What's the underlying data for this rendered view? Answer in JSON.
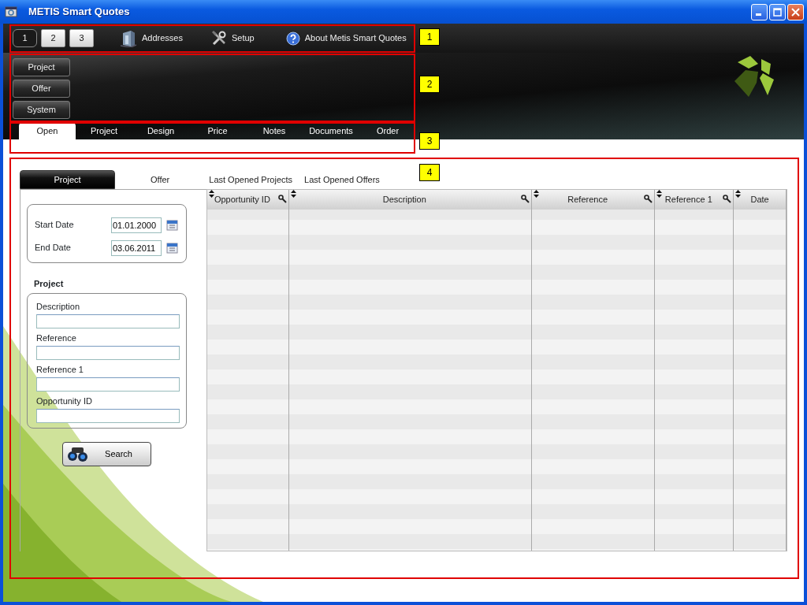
{
  "window": {
    "title": "METIS Smart Quotes"
  },
  "toolbar": {
    "pages": [
      {
        "label": "1",
        "selected": true
      },
      {
        "label": "2",
        "selected": false
      },
      {
        "label": "3",
        "selected": false
      }
    ],
    "items": [
      {
        "label": "Addresses",
        "kind": "addresses"
      },
      {
        "label": "Setup",
        "kind": "setup"
      },
      {
        "label": "About Metis Smart Quotes",
        "kind": "about"
      }
    ]
  },
  "side_menu": [
    {
      "label": "Project"
    },
    {
      "label": "Offer"
    },
    {
      "label": "System"
    }
  ],
  "tabs": [
    {
      "label": "Open",
      "selected": true
    },
    {
      "label": "Project",
      "selected": false
    },
    {
      "label": "Design",
      "selected": false
    },
    {
      "label": "Price",
      "selected": false
    },
    {
      "label": "Notes",
      "selected": false
    },
    {
      "label": "Documents",
      "selected": false
    },
    {
      "label": "Order",
      "selected": false
    }
  ],
  "subtabs": [
    {
      "label": "Project",
      "selected": true
    },
    {
      "label": "Offer",
      "selected": false
    },
    {
      "label": "Last Opened Projects",
      "selected": false
    },
    {
      "label": "Last Opened Offers",
      "selected": false
    }
  ],
  "dates": [
    {
      "label": "Start Date",
      "value": "01.01.2000"
    },
    {
      "label": "End Date",
      "value": "03.06.2011"
    }
  ],
  "project_filter": {
    "heading": "Project",
    "fields": [
      {
        "label": "Description"
      },
      {
        "label": "Reference"
      },
      {
        "label": "Reference 1"
      },
      {
        "label": "Opportunity ID"
      }
    ]
  },
  "search_button": "Search",
  "table": {
    "columns": [
      {
        "label": "Opportunity ID",
        "filterable": true
      },
      {
        "label": "Description",
        "filterable": true
      },
      {
        "label": "Reference",
        "filterable": true
      },
      {
        "label": "Reference 1",
        "filterable": true
      },
      {
        "label": "Date",
        "filterable": false
      }
    ]
  },
  "annotations": [
    {
      "label": "1"
    },
    {
      "label": "2"
    },
    {
      "label": "3"
    },
    {
      "label": "4"
    }
  ]
}
